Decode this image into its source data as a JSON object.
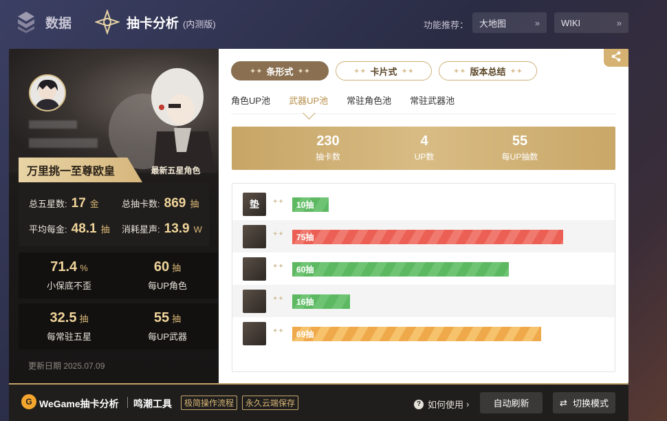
{
  "topnav": {
    "data_label": "数据",
    "gacha_label": "抽卡分析",
    "gacha_sub": "(内测版)",
    "feature_label": "功能推荐：",
    "feature_map": "大地图",
    "feature_wiki": "WIKI"
  },
  "profile": {
    "title": "万里挑一至尊欧皇",
    "latest_label": "最新五星角色",
    "updated": "更新日期 2025.07.09"
  },
  "stats": {
    "total_five_label": "总五星数:",
    "total_five_value": "17",
    "total_five_unit": "金",
    "total_pulls_label": "总抽卡数:",
    "total_pulls_value": "869",
    "total_pulls_unit": "抽",
    "avg_label": "平均每金:",
    "avg_value": "48.1",
    "avg_unit": "抽",
    "astrite_label": "消耗星声:",
    "astrite_value": "13.9",
    "astrite_unit": "W"
  },
  "tiles": [
    {
      "value": "71.4",
      "unit": "%",
      "label": "小保底不歪"
    },
    {
      "value": "60",
      "unit": "抽",
      "label": "每UP角色"
    },
    {
      "value": "32.5",
      "unit": "抽",
      "label": "每常驻五星"
    },
    {
      "value": "55",
      "unit": "抽",
      "label": "每UP武器"
    }
  ],
  "modes": [
    {
      "label": "条形式",
      "active": true
    },
    {
      "label": "卡片式",
      "active": false
    },
    {
      "label": "版本总结",
      "active": false
    }
  ],
  "pool_tabs": [
    {
      "label": "角色UP池",
      "active": false
    },
    {
      "label": "武器UP池",
      "active": true
    },
    {
      "label": "常驻角色池",
      "active": false
    },
    {
      "label": "常驻武器池",
      "active": false
    }
  ],
  "summary": [
    {
      "value": "230",
      "label": "抽卡数"
    },
    {
      "value": "4",
      "label": "UP数"
    },
    {
      "value": "55",
      "label": "每UP抽数"
    }
  ],
  "pulls": [
    {
      "thumb_text": "垫",
      "label": "10抽",
      "count": 10,
      "color": "green"
    },
    {
      "thumb_text": "",
      "label": "75抽",
      "count": 75,
      "color": "red"
    },
    {
      "thumb_text": "",
      "label": "60抽",
      "count": 60,
      "color": "green"
    },
    {
      "thumb_text": "",
      "label": "16抽",
      "count": 16,
      "color": "green"
    },
    {
      "thumb_text": "",
      "label": "69抽",
      "count": 69,
      "color": "orange"
    }
  ],
  "pull_max": 80,
  "footer": {
    "title": "WeGame抽卡分析",
    "tool": "鸣潮工具",
    "badge1": "极简操作流程",
    "badge2": "永久云端保存",
    "help": "如何使用",
    "refresh": "自动刷新",
    "switch": "切换模式"
  },
  "colors": {
    "gold": "#d5b271",
    "green": "#5db862",
    "red": "#ec5f54",
    "orange": "#efa94a"
  }
}
